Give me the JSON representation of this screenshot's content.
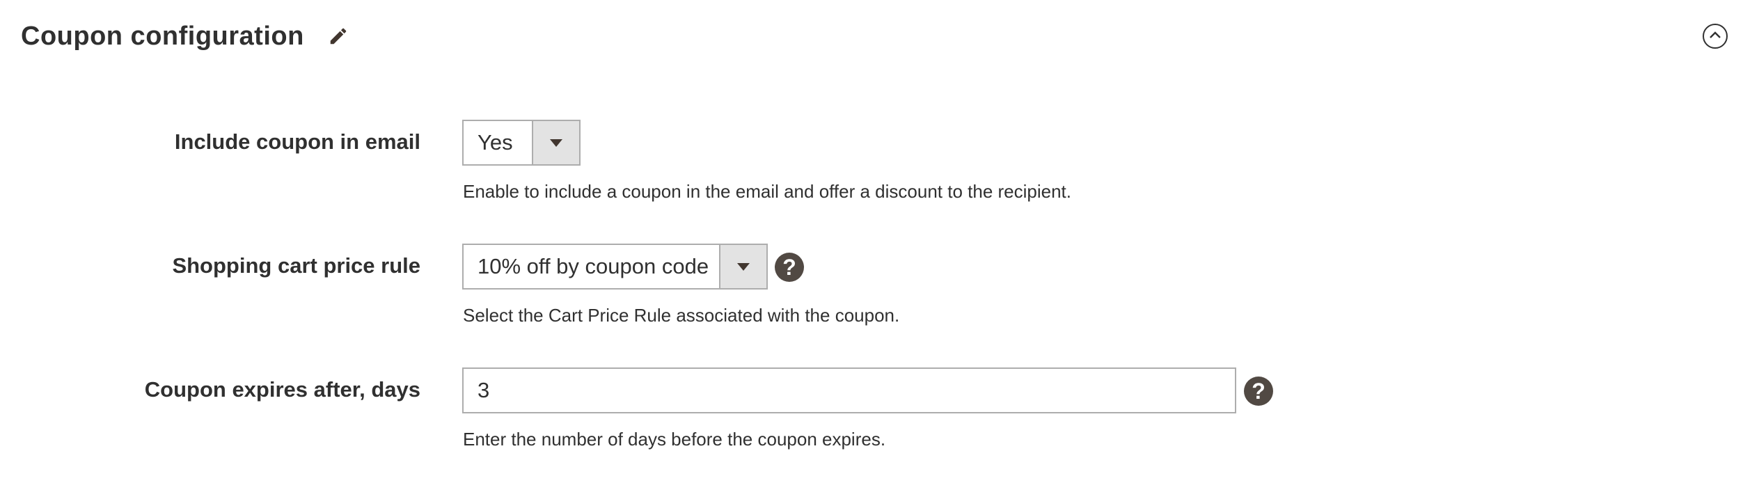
{
  "section": {
    "title": "Coupon configuration"
  },
  "fields": {
    "include_coupon": {
      "label": "Include coupon in email",
      "value": "Yes",
      "note": "Enable to include a coupon in the email and offer a discount to the recipient."
    },
    "price_rule": {
      "label": "Shopping cart price rule",
      "value": "10% off by coupon code",
      "note": "Select the Cart Price Rule associated with the coupon."
    },
    "expires_days": {
      "label": "Coupon expires after, days",
      "value": "3",
      "note": "Enter the number of days before the coupon expires."
    }
  },
  "icons": {
    "edit": "pencil-icon",
    "collapse": "chevron-up-circle-icon",
    "help": "question-mark-icon",
    "dropdown": "caret-down-icon"
  },
  "colors": {
    "text": "#303030",
    "help_bg": "#514943",
    "border": "#adadad",
    "select_arrow_bg": "#e3e3e3"
  }
}
